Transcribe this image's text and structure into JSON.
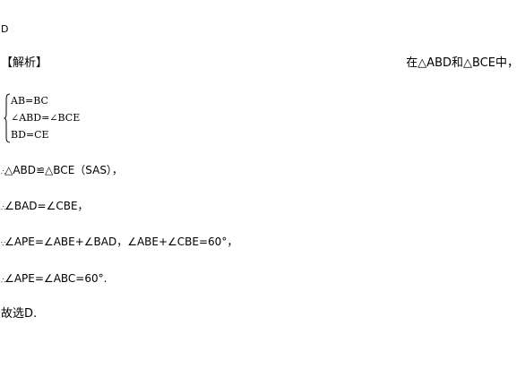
{
  "answer": "D",
  "heading": "【解析】",
  "given": "在△ABD和△BCE中，",
  "system": [
    "AB=BC",
    "∠ABD=∠BCE",
    "BD=CE"
  ],
  "steps": [
    {
      "mark": "∴",
      "text": "△ABD≌△BCE（SAS），"
    },
    {
      "mark": "∴",
      "text": "∠BAD=∠CBE，"
    },
    {
      "mark": "∵",
      "text": "∠APE=∠ABE+∠BAD，∠ABE+∠CBE=60°，"
    },
    {
      "mark": "∴",
      "text": "∠APE=∠ABC=60°."
    }
  ],
  "conclusion": "故选D."
}
